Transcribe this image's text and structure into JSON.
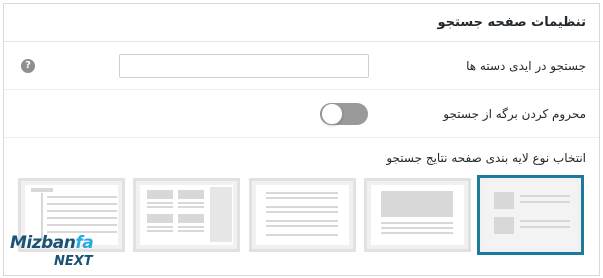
{
  "panel": {
    "title": "تنظیمات صفحه جستجو"
  },
  "category_search": {
    "label": "جستجو در ایدی دسته ها",
    "value": "",
    "help_icon": "question-icon",
    "help_glyph": "?"
  },
  "exclude_page": {
    "label": "محروم کردن برگه از جستجو",
    "toggle_state": "off"
  },
  "layout_selector": {
    "label": "انتخاب نوع لایه بندی صفحه نتایج جستجو",
    "options": [
      "grid-thumbnails",
      "featured-image-list",
      "text-list",
      "two-column-grid",
      "sidebar-list"
    ],
    "selected": "grid-thumbnails",
    "selected_color": "#1e7a9c"
  },
  "watermark": {
    "brand": "Mizban",
    "brand_accent": "fa",
    "sub": "NEXT"
  }
}
